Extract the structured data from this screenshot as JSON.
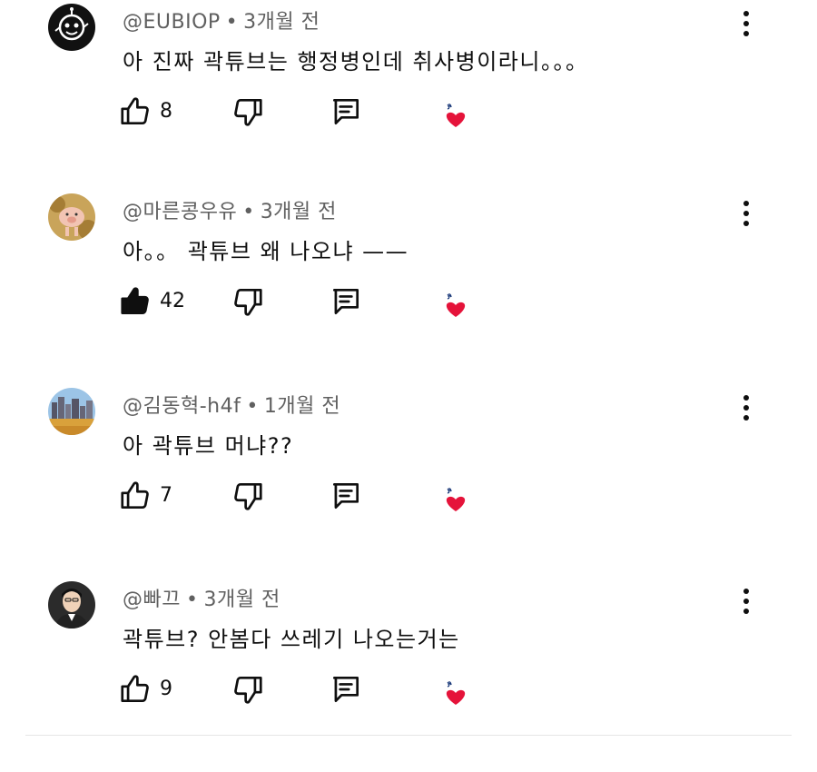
{
  "comments": [
    {
      "author": "@EUBIOP",
      "time": "3개월 전",
      "text": "아 진짜 곽튜브는 행정병인데 취사병이라니。。。",
      "likes": "8",
      "liked": false,
      "avatar": "robot"
    },
    {
      "author": "@마른콩우유",
      "time": "3개월 전",
      "text": "아。。 곽튜브 왜 나오냐 ——",
      "likes": "42",
      "liked": true,
      "avatar": "pig"
    },
    {
      "author": "@김동혁-h4f",
      "time": "1개월 전",
      "text": "아 곽튜브 머냐??",
      "likes": "7",
      "liked": false,
      "avatar": "city"
    },
    {
      "author": "@빠끄",
      "time": "3개월 전",
      "text": "곽튜브? 안봄다 쓰레기 나오는거는",
      "likes": "9",
      "liked": false,
      "avatar": "person"
    }
  ],
  "separator": "•",
  "icons": {
    "like": "thumbs-up-icon",
    "dislike": "thumbs-down-icon",
    "reply": "reply-icon",
    "creator_heart": "creator-heart-icon",
    "menu": "more-vert-icon"
  },
  "colors": {
    "heart": "#e5133a",
    "text": "#0f0f0f",
    "meta": "#606060"
  }
}
